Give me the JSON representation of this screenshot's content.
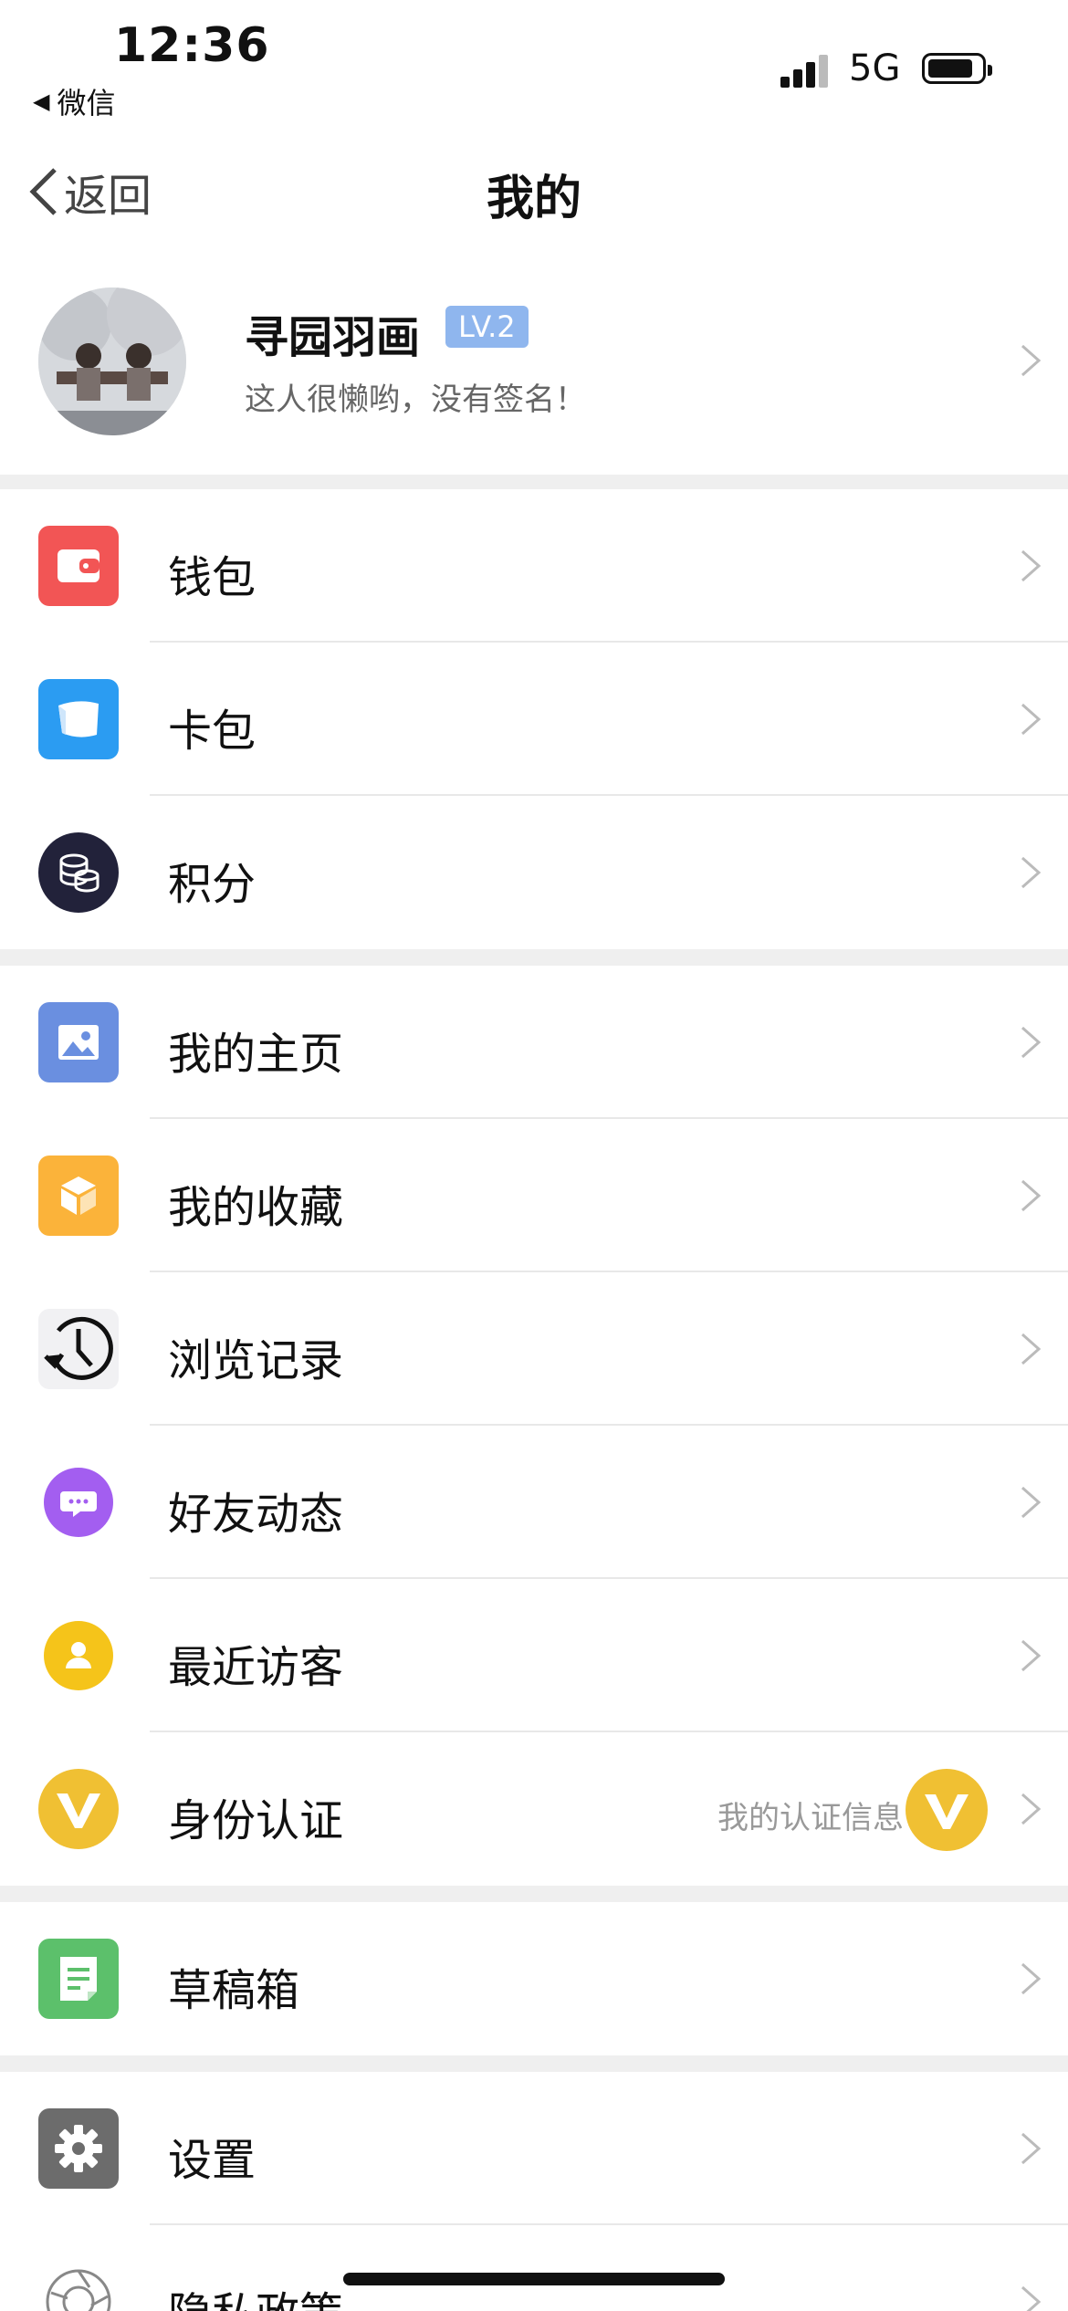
{
  "status": {
    "time": "12:36",
    "back_app": "微信",
    "network": "5G"
  },
  "nav": {
    "back_label": "返回",
    "title": "我的"
  },
  "profile": {
    "name": "寻园羽画",
    "level": "LV.2",
    "signature": "这人很懒哟，没有签名！"
  },
  "sections": [
    {
      "items": [
        {
          "label": "钱包",
          "icon": "wallet-icon",
          "color": "#f25555"
        },
        {
          "label": "卡包",
          "icon": "card-icon",
          "color": "#2b9cf2"
        },
        {
          "label": "积分",
          "icon": "coins-icon",
          "color": "#22223a"
        }
      ]
    },
    {
      "items": [
        {
          "label": "我的主页",
          "icon": "image-icon",
          "color": "#6a8fe0"
        },
        {
          "label": "我的收藏",
          "icon": "box-icon",
          "color": "#fbb33a"
        },
        {
          "label": "浏览记录",
          "icon": "history-icon",
          "color": "#222"
        },
        {
          "label": "好友动态",
          "icon": "chat-icon",
          "color": "#a35ef0"
        },
        {
          "label": "最近访客",
          "icon": "user-icon",
          "color": "#f5c41a"
        },
        {
          "label": "身份认证",
          "icon": "v-badge-icon",
          "color": "#f0c033",
          "extra": "我的认证信息"
        }
      ]
    },
    {
      "items": [
        {
          "label": "草稿箱",
          "icon": "draft-icon",
          "color": "#5cc06b"
        }
      ]
    },
    {
      "items": [
        {
          "label": "设置",
          "icon": "gear-icon",
          "color": "#6c6c6c"
        },
        {
          "label": "隐私政策",
          "icon": "privacy-icon",
          "color": "#888"
        }
      ]
    }
  ]
}
